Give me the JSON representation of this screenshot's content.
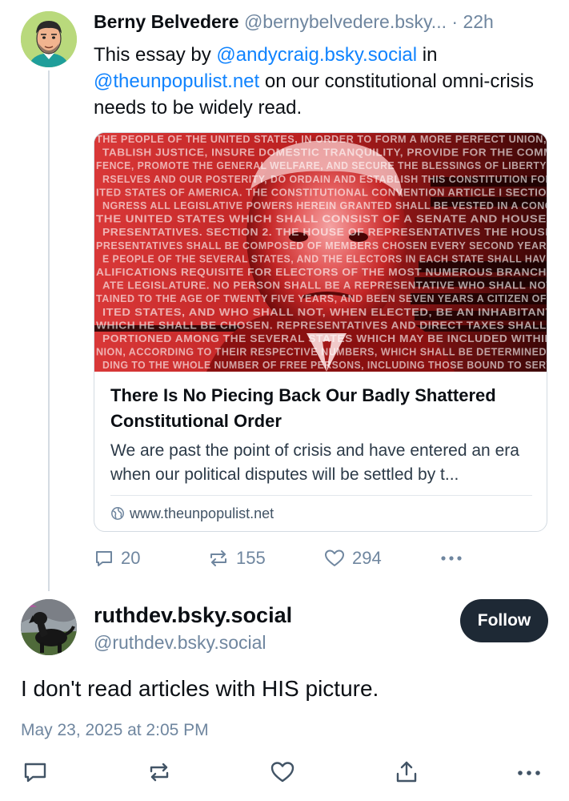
{
  "parent_post": {
    "author_name": "Berny Belvedere",
    "author_handle": "@bernybelvedere.bsky...",
    "separator": "·",
    "time": "22h",
    "text_before": "This essay by ",
    "mention1": "@andycraig.bsky.social",
    "text_middle": " in ",
    "mention2": "@theunpopulist.net",
    "text_after": " on our constitutional omni-crisis needs to be widely read.",
    "card": {
      "image_text_rows": [
        "THE PEOPLE OF THE UNITED STATES, IN ORDER TO FORM A MORE PERFECT UNION,",
        "TABLISH JUSTICE, INSURE DOMESTIC TRANQUILITY, PROVIDE FOR THE COMM",
        "FENCE, PROMOTE THE GENERAL WELFARE, AND SECURE THE BLESSINGS OF LIBERTY",
        "RSELVES AND OUR POSTERITY, DO ORDAIN AND ESTABLISH THIS CONSTITUTION FOR",
        "ITED STATES OF AMERICA. THE CONSTITUTIONAL CONVENTION ARTICLE I SECTIO",
        "NGRESS ALL LEGISLATIVE POWERS HEREIN GRANTED SHALL BE VESTED IN A CONG",
        "THE UNITED STATES WHICH SHALL CONSIST OF A SENATE AND HOUSE",
        "PRESENTATIVES. SECTION 2. THE HOUSE OF REPRESENTATIVES THE HOUSE",
        "PRESENTATIVES SHALL BE COMPOSED OF MEMBERS CHOSEN EVERY SECOND YEAR",
        "E PEOPLE OF THE SEVERAL STATES, AND THE ELECTORS IN EACH STATE SHALL HAVE",
        "ALIFICATIONS REQUISITE FOR ELECTORS OF THE MOST NUMEROUS BRANCH",
        "ATE LEGISLATURE. NO PERSON SHALL BE A REPRESENTATIVE WHO SHALL NOT",
        "TAINED TO THE AGE OF TWENTY FIVE YEARS, AND BEEN SEVEN YEARS A CITIZEN OF",
        "ITED STATES, AND WHO SHALL NOT, WHEN ELECTED, BE AN INHABITANT",
        "WHICH HE SHALL BE CHOSEN. REPRESENTATIVES AND DIRECT TAXES SHALL",
        "PORTIONED AMONG THE SEVERAL STATES WHICH MAY BE INCLUDED WITHIN",
        "NION, ACCORDING TO THEIR RESPECTIVE NUMBERS, WHICH SHALL BE DETERMINED",
        "DING TO THE WHOLE NUMBER OF FREE PERSONS, INCLUDING THOSE BOUND TO SERV"
      ],
      "title": "There Is No Piecing Back Our Badly Shattered Constitutional Order",
      "description": "We are past the point of crisis and have entered an era when our political disputes will be settled by t...",
      "domain": "www.theunpopulist.net"
    },
    "replies": "20",
    "reposts": "155",
    "likes": "294"
  },
  "reply_post": {
    "author_name": "ruthdev.bsky.social",
    "author_handle": "@ruthdev.bsky.social",
    "follow_label": "Follow",
    "text": "I don't read articles with HIS picture.",
    "date": "May 23, 2025 at 2:05 PM"
  },
  "colors": {
    "accent": "#1083fe",
    "muted": "#6f869f",
    "follow_bg": "#1e2935"
  },
  "icons": {
    "reply": "speech-bubble-icon",
    "repost": "repost-arrows-icon",
    "like": "heart-icon",
    "more": "ellipsis-icon",
    "share": "share-upload-icon",
    "globe": "globe-icon"
  }
}
